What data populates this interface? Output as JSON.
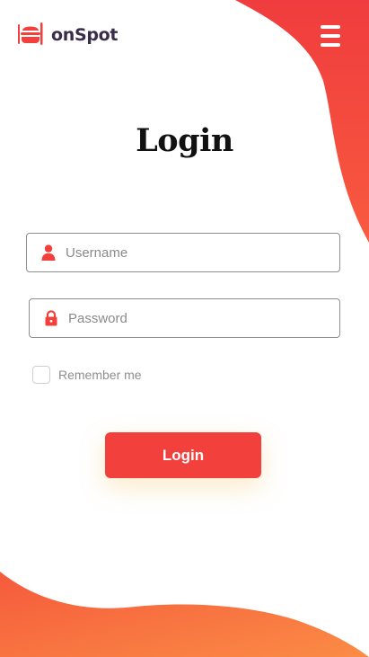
{
  "header": {
    "app_name": "onSpot",
    "logo_icon": "burger-logo-icon",
    "menu_icon": "hamburger-menu-icon"
  },
  "form": {
    "title": "Login",
    "username": {
      "placeholder": "Username",
      "value": "",
      "icon": "user-icon"
    },
    "password": {
      "placeholder": "Password",
      "value": "",
      "icon": "lock-icon"
    },
    "remember_label": "Remember me",
    "remember_checked": false,
    "submit_label": "Login"
  },
  "colors": {
    "accent": "#f2413d",
    "gradient_start": "#f03c3e",
    "gradient_end": "#fb8c45",
    "logo_text": "#3a2d4a",
    "title_text": "#111111"
  }
}
